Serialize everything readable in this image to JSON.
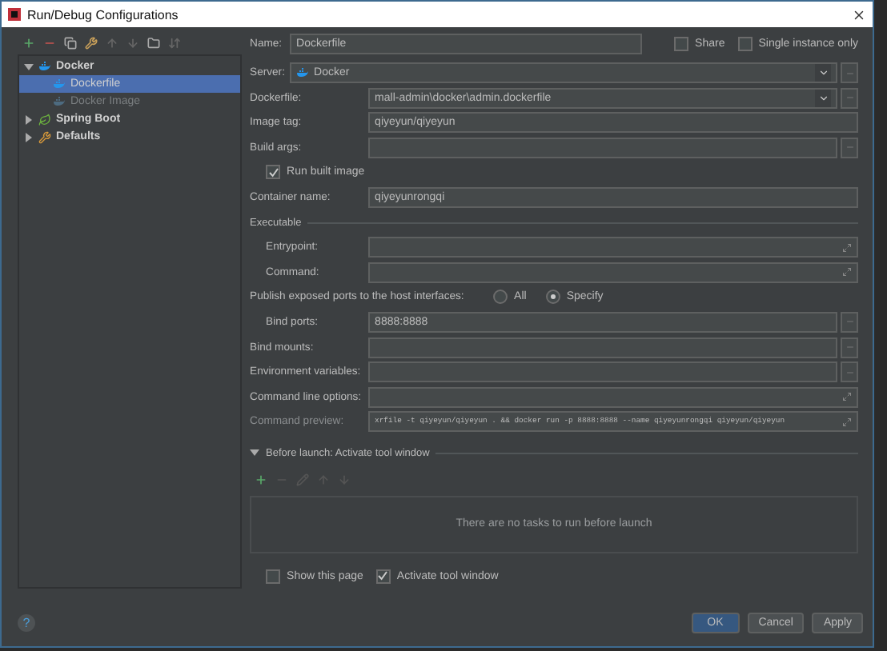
{
  "window": {
    "title": "Run/Debug Configurations"
  },
  "tree": [
    {
      "label": "Docker",
      "expanded": true,
      "children": [
        {
          "label": "Dockerfile",
          "selected": true,
          "disabled": false
        },
        {
          "label": "Docker Image",
          "selected": false,
          "disabled": true
        }
      ]
    },
    {
      "label": "Spring Boot",
      "expanded": false
    },
    {
      "label": "Defaults",
      "expanded": false
    }
  ],
  "name": {
    "label": "Name:",
    "value": "Dockerfile"
  },
  "options": [
    {
      "label": "Share",
      "checked": false
    },
    {
      "label": "Single instance only",
      "checked": false
    }
  ],
  "server": {
    "label": "Server:",
    "value": "Docker"
  },
  "rows": [
    {
      "kind": "dropdown",
      "label": "Dockerfile:",
      "value": "mall-admin\\docker\\admin.dockerfile",
      "indented": false
    },
    {
      "kind": "text",
      "label": "Image tag:",
      "value": "qiyeyun/qiyeyun",
      "indented": false
    },
    {
      "kind": "browse",
      "label": "Build args:",
      "value": "",
      "indented": false
    },
    {
      "kind": "checkbox",
      "label": "Run built image",
      "checked": true,
      "indented": true
    },
    {
      "kind": "text",
      "label": "Container name:",
      "value": "qiyeyunrongqi",
      "indented": false
    },
    {
      "kind": "section",
      "label": "Executable"
    },
    {
      "kind": "expand",
      "label": "Entrypoint:",
      "value": "",
      "indented": true
    },
    {
      "kind": "expand",
      "label": "Command:",
      "value": "",
      "indented": true
    },
    {
      "kind": "radio",
      "label": "Publish exposed ports to the host interfaces:",
      "choices": [
        {
          "label": "All",
          "selected": false
        },
        {
          "label": "Specify",
          "selected": true
        }
      ],
      "indented": false
    },
    {
      "kind": "browse",
      "label": "Bind ports:",
      "value": "8888:8888",
      "indented": true
    },
    {
      "kind": "browse",
      "label": "Bind mounts:",
      "value": "",
      "indented": false
    },
    {
      "kind": "browse",
      "label": "Environment variables:",
      "value": "",
      "indented": false
    },
    {
      "kind": "expand",
      "label": "Command line options:",
      "value": "",
      "indented": false
    },
    {
      "kind": "preview",
      "label": "Command preview:",
      "value": "xrfile -t qiyeyun/qiyeyun . && docker run -p 8888:8888 --name qiyeyunrongqi qiyeyun/qiyeyun",
      "indented": false
    }
  ],
  "before_launch": {
    "title": "Before launch: Activate tool window",
    "expanded": true,
    "empty_text": "There are no tasks to run before launch"
  },
  "bottom_options": [
    {
      "label": "Show this page",
      "checked": false
    },
    {
      "label": "Activate tool window",
      "checked": true
    }
  ],
  "help_button": "?",
  "buttons": [
    {
      "label": "OK",
      "primary": true
    },
    {
      "label": "Cancel",
      "primary": false
    },
    {
      "label": "Apply",
      "primary": false
    }
  ]
}
